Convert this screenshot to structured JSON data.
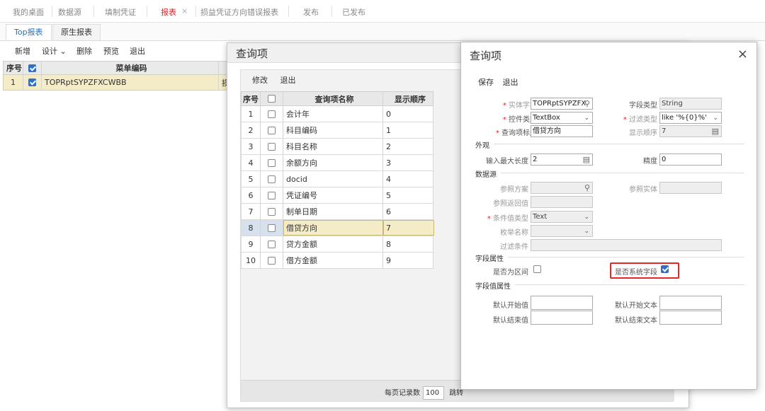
{
  "topbar": {
    "tabs": [
      "我的桌面",
      "数据源",
      "填制凭证",
      "报表",
      "损益凭证方向错误报表",
      "发布",
      "已发布"
    ],
    "active": "报表",
    "close_glyph": "×"
  },
  "subtabs": [
    "Top报表",
    "原生报表"
  ],
  "toolbar": {
    "new": "新增",
    "design": "设计",
    "delete": "删除",
    "preview": "预览",
    "exit": "退出"
  },
  "base_grid": {
    "headers": {
      "no": "序号",
      "code": "菜单编码"
    },
    "row": {
      "no": "1",
      "code": "TOPRptSYPZFXCWBB",
      "extra": "损"
    }
  },
  "dialog1": {
    "title": "查询项",
    "toolbar": {
      "modify": "修改",
      "exit": "退出"
    },
    "headers": {
      "no": "序号",
      "name": "查询项名称",
      "order": "显示顺序"
    },
    "rows": [
      {
        "no": "1",
        "name": "会计年",
        "order": "0"
      },
      {
        "no": "2",
        "name": "科目编码",
        "order": "1"
      },
      {
        "no": "3",
        "name": "科目名称",
        "order": "2"
      },
      {
        "no": "4",
        "name": "余额方向",
        "order": "3"
      },
      {
        "no": "5",
        "name": "docid",
        "order": "4"
      },
      {
        "no": "6",
        "name": "凭证编号",
        "order": "5"
      },
      {
        "no": "7",
        "name": "制单日期",
        "order": "6"
      },
      {
        "no": "8",
        "name": "借贷方向",
        "order": "7"
      },
      {
        "no": "9",
        "name": "贷方金额",
        "order": "8"
      },
      {
        "no": "10",
        "name": "借方金额",
        "order": "9"
      }
    ],
    "selected_row": "8",
    "footer": {
      "per_page_label": "每页记录数",
      "per_page_value": "100",
      "jump_label": "跳转"
    }
  },
  "dialog2": {
    "title": "查询项",
    "close": "×",
    "toolbar": {
      "save": "保存",
      "exit": "退出"
    },
    "fields": {
      "entity_field_label": "实体字段",
      "entity_field_value": "TOPRptSYPZFX",
      "field_type_label": "字段类型",
      "field_type_value": "String",
      "control_type_label": "控件类型",
      "control_type_value": "TextBox",
      "filter_type_label": "过滤类型",
      "filter_type_value": "like '%{0}%'",
      "query_title_label": "查询项标题",
      "query_title_value": "借贷方向",
      "display_order_label": "显示顺序",
      "display_order_value": "7"
    },
    "sections": {
      "appearance": "外观",
      "datasource": "数据源",
      "field_attr": "字段属性",
      "field_value_attr": "字段值属性"
    },
    "appearance": {
      "max_len_label": "输入最大长度",
      "max_len_value": "2",
      "precision_label": "精度",
      "precision_value": "0"
    },
    "datasource": {
      "ref_scheme": "参照方案",
      "ref_entity": "参照实体",
      "ref_return": "参照返回值",
      "cond_type_label": "条件值类型",
      "cond_type_value": "Text",
      "enum_name": "枚举名称",
      "filter_cond": "过滤条件"
    },
    "field_attr": {
      "is_range": "是否为区间",
      "is_system": "是否系统字段"
    },
    "field_value_attr": {
      "default_start": "默认开始值",
      "default_start_text": "默认开始文本",
      "default_end": "默认结束值",
      "default_end_text": "默认结束文本"
    }
  }
}
